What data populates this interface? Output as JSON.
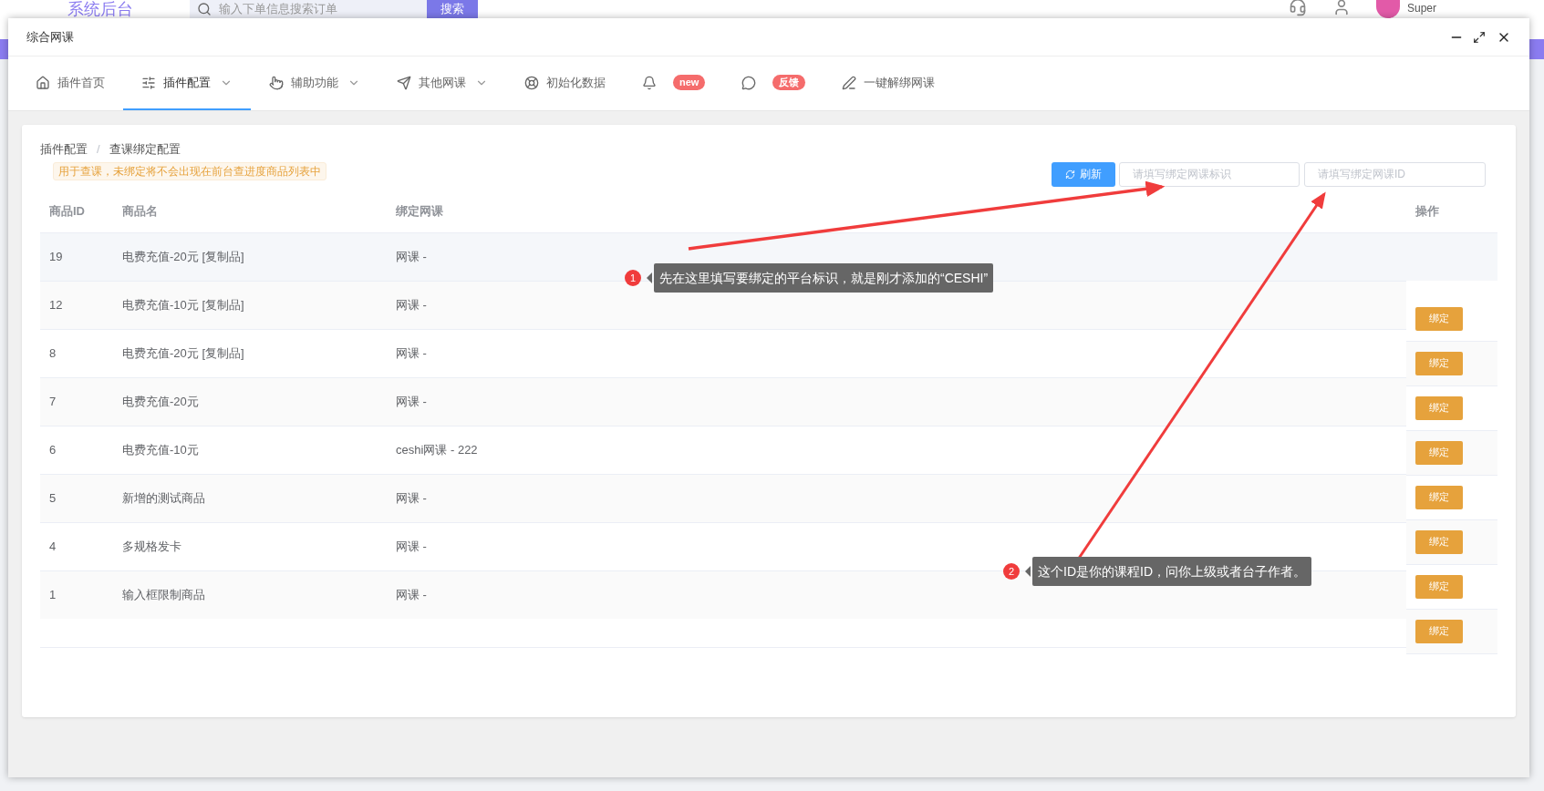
{
  "background_header": {
    "logo": "系统后台",
    "search": {
      "placeholder": "输入下单信息搜索订单",
      "button": "搜索"
    },
    "user": "Super"
  },
  "window": {
    "title": "综合网课"
  },
  "tabs": [
    {
      "label": "插件首页",
      "selected": false,
      "dropdown": false
    },
    {
      "label": "插件配置",
      "selected": true,
      "dropdown": true
    },
    {
      "label": "辅助功能",
      "selected": false,
      "dropdown": true
    },
    {
      "label": "其他网课",
      "selected": false,
      "dropdown": true
    },
    {
      "label": "初始化数据",
      "selected": false,
      "dropdown": false
    },
    {
      "badge": "new",
      "selected": false,
      "dropdown": false
    },
    {
      "badge": "反馈",
      "selected": false,
      "dropdown": false
    },
    {
      "label": "一键解绑网课",
      "selected": false,
      "dropdown": false
    }
  ],
  "breadcrumb": {
    "separator": "/",
    "items": [
      "插件配置",
      "查课绑定配置"
    ]
  },
  "notice": "用于查课，未绑定将不会出现在前台查进度商品列表中",
  "toolbar": {
    "refresh": "刷新",
    "platform_field": {
      "placeholder": "请填写绑定网课标识"
    },
    "id_field": {
      "placeholder": "请填写绑定网课ID"
    }
  },
  "table": {
    "columns": [
      "商品ID",
      "商品名",
      "绑定网课",
      "操作"
    ],
    "rows": [
      {
        "id": "19",
        "name": "电费充值-20元 [复制品]",
        "course": "网课 -",
        "selected": true
      },
      {
        "id": "12",
        "name": "电费充值-10元 [复制品]",
        "course": "网课 -",
        "selected": false
      },
      {
        "id": "8",
        "name": "电费充值-20元 [复制品]",
        "course": "网课 -",
        "selected": false
      },
      {
        "id": "7",
        "name": "电费充值-20元",
        "course": "网课 -",
        "selected": false
      },
      {
        "id": "6",
        "name": "电费充值-10元",
        "course": "ceshi网课 - 222",
        "selected": false
      },
      {
        "id": "5",
        "name": "新增的测试商品",
        "course": "网课 -",
        "selected": false
      },
      {
        "id": "4",
        "name": "多规格发卡",
        "course": "网课 -",
        "selected": false
      },
      {
        "id": "1",
        "name": "输入框限制商品",
        "course": "网课 -",
        "selected": false
      }
    ],
    "actions": [
      "绑定",
      "绑定",
      "绑定",
      "绑定",
      "绑定",
      "绑定",
      "绑定",
      "绑定"
    ]
  },
  "annotations": [
    {
      "number": "1",
      "text": "先在这里填写要绑定的平台标识，就是刚才添加的“CESHI”"
    },
    {
      "number": "2",
      "text": "这个ID是你的课程ID，问你上级或者台子作者。"
    }
  ]
}
